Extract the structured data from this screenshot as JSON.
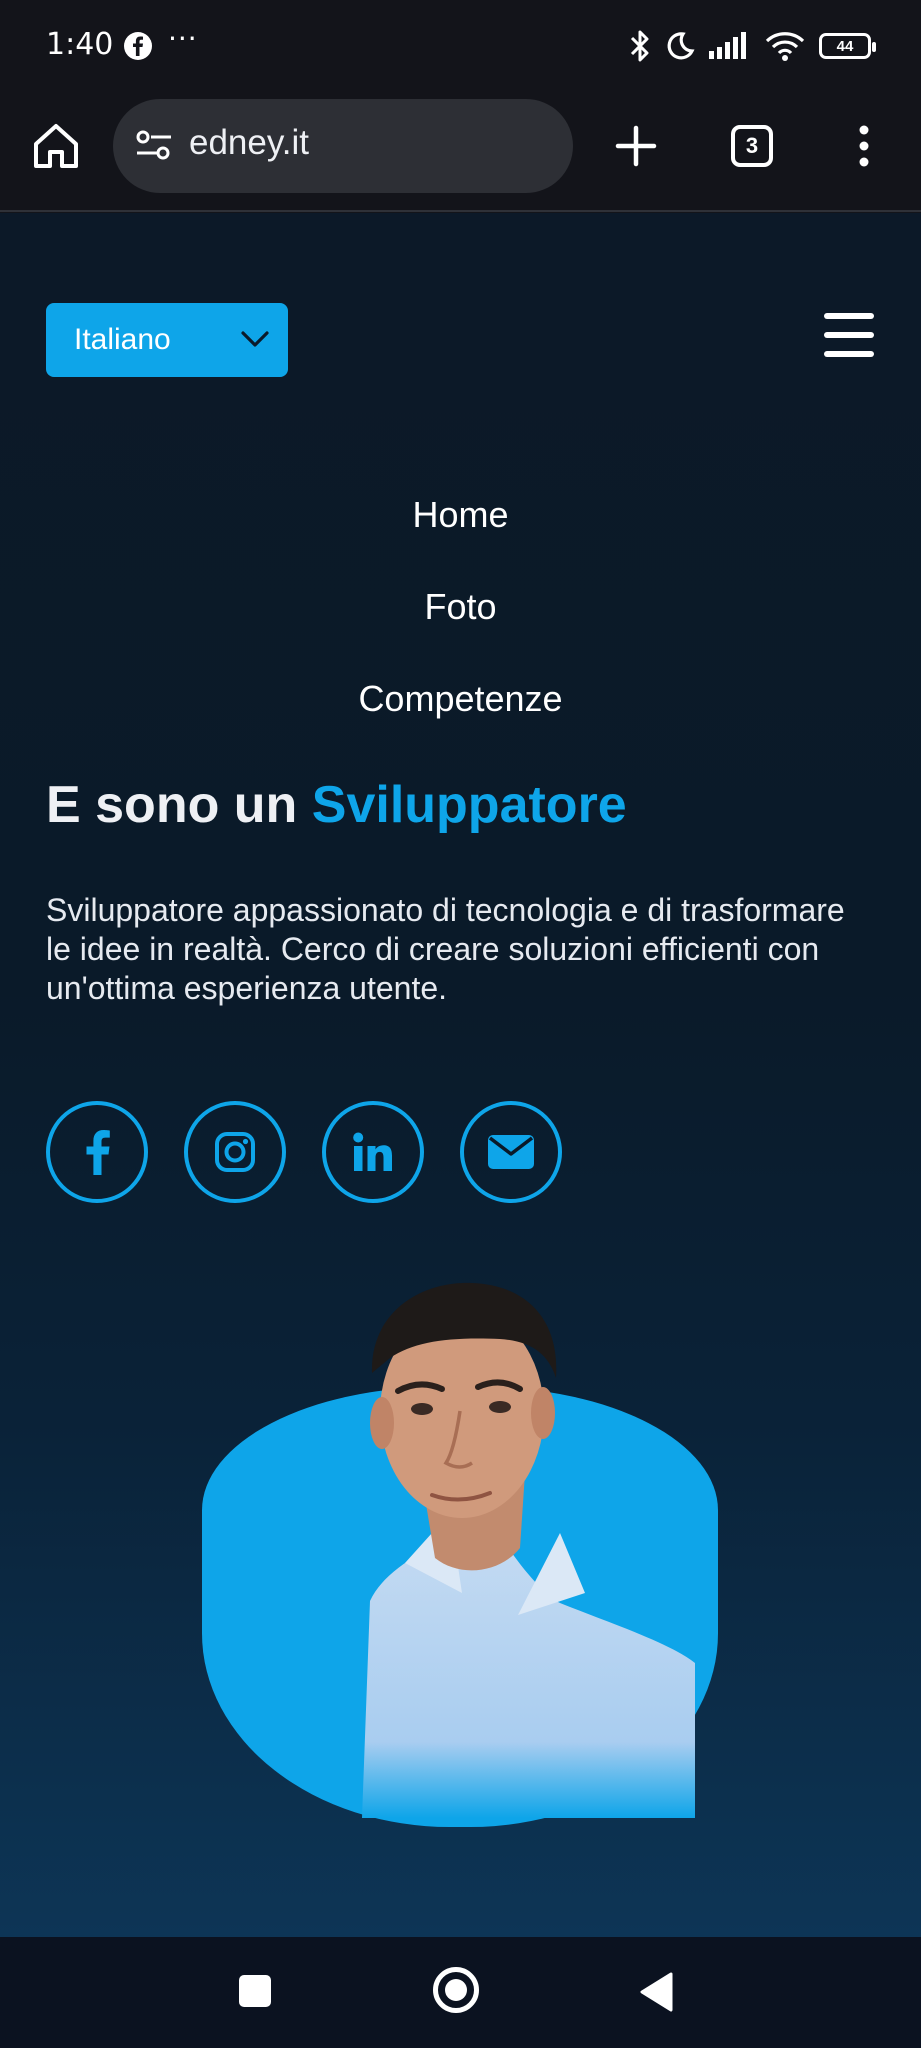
{
  "status_bar": {
    "time": "1:40",
    "overflow": "···",
    "battery": "44",
    "icons": [
      "facebook-icon",
      "bluetooth-icon",
      "do-not-disturb-moon-icon",
      "cellular-signal-icon",
      "wifi-icon",
      "battery-icon"
    ]
  },
  "browser": {
    "url": "edney.it",
    "tab_count": "3",
    "icons": [
      "home-icon",
      "site-settings-icon",
      "new-tab-plus-icon",
      "tab-switcher-icon",
      "more-vert-icon"
    ]
  },
  "page": {
    "language_select": {
      "selected": "Italiano"
    },
    "nav": [
      "Home",
      "Foto",
      "Competenze"
    ],
    "hero": {
      "title_prefix": "E sono un",
      "title_accent": "Sviluppatore",
      "description": "Sviluppatore appassionato di tecnologia e di trasformare le idee in realtà. Cerco di creare soluzioni efficienti con un'ottima esperienza utente."
    },
    "socials": [
      "facebook-icon",
      "instagram-icon",
      "linkedin-icon",
      "envelope-icon"
    ]
  },
  "colors": {
    "accent": "#0ea5e9",
    "page_background": "#0c1928",
    "status_bar": "#13141a"
  }
}
